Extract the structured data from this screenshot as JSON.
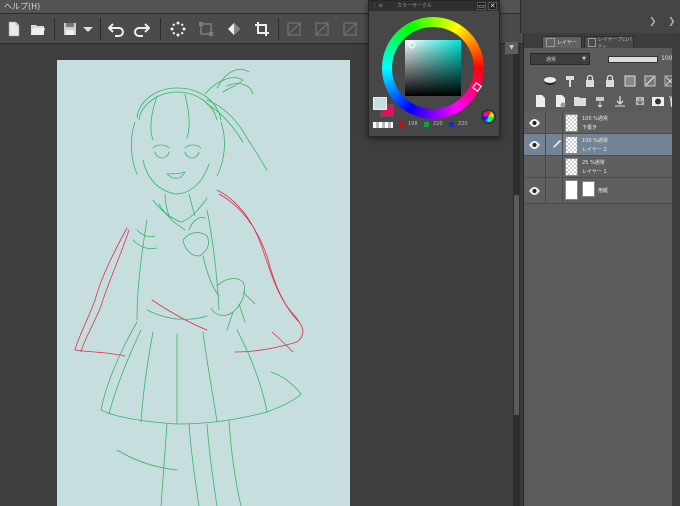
{
  "menubar": {
    "label": "ヘルプ(H)"
  },
  "toolbar": {
    "icons": [
      "new-file-icon",
      "open-file-icon",
      "save-icon",
      "dropdown-icon",
      "undo-icon",
      "redo-icon",
      "loading-icon",
      "transform-icon",
      "fill-icon",
      "crop-icon",
      "disabled-tool-icon"
    ]
  },
  "color_wheel": {
    "title": "カラーサークル",
    "main_color": "#c6dedd",
    "sub_color": "#e01060",
    "r": "198",
    "g": "220",
    "b": "220",
    "close_label": "✕",
    "menu_label": "▭"
  },
  "layer_panel": {
    "tab_layer": "レイヤー",
    "tab_property": "レイヤープロパティ",
    "blend_mode": "通常",
    "opacity": "100",
    "opacity_fraction": 1.0,
    "layers": [
      {
        "line1": "100 %通常",
        "line2": "下書き",
        "selected": false,
        "visible": true,
        "editing": false
      },
      {
        "line1": "100 %通常",
        "line2": "レイヤー 2",
        "selected": true,
        "visible": true,
        "editing": true
      },
      {
        "line1": "25 %通常",
        "line2": "レイヤー 1",
        "selected": false,
        "visible": true,
        "editing": false
      },
      {
        "label": "用紙",
        "selected": false,
        "visible": true,
        "paper": true
      }
    ]
  },
  "canvas": {
    "paper_color": "#c6dedd",
    "sketch_color": "#3ab36a",
    "red_color": "#e0304a"
  }
}
